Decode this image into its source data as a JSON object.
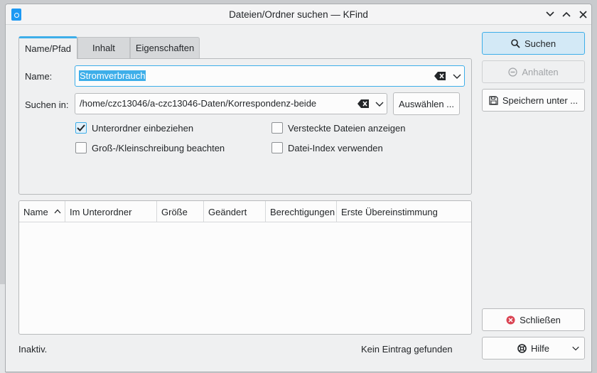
{
  "window": {
    "title": "Dateien/Ordner suchen — KFind"
  },
  "tabs": [
    {
      "label": "Name/Pfad",
      "active": true
    },
    {
      "label": "Inhalt",
      "active": false
    },
    {
      "label": "Eigenschaften",
      "active": false
    }
  ],
  "form": {
    "name_label": "Name:",
    "name_value": "Stromverbrauch",
    "lookin_label": "Suchen in:",
    "lookin_value": "/home/czc13046/a-czc13046-Daten/Korrespondenz-beide",
    "browse_label": "Auswählen ..."
  },
  "options": {
    "subfolders": {
      "label": "Unterordner einbeziehen",
      "checked": true
    },
    "case_sensitive": {
      "label": "Groß-/Kleinschreibung beachten",
      "checked": false
    },
    "hidden_files": {
      "label": "Versteckte Dateien anzeigen",
      "checked": false
    },
    "file_index": {
      "label": "Datei-Index verwenden",
      "checked": false
    }
  },
  "results": {
    "columns": [
      "Name",
      "Im Unterordner",
      "Größe",
      "Geändert",
      "Berechtigungen",
      "Erste Übereinstimmung"
    ],
    "sort_column": "Name",
    "sort_direction": "ascending",
    "rows": []
  },
  "buttons": {
    "search": "Suchen",
    "stop": "Anhalten",
    "save_as": "Speichern unter ...",
    "close": "Schließen",
    "help": "Hilfe"
  },
  "status": {
    "left": "Inaktiv.",
    "right": "Kein Eintrag gefunden"
  },
  "colors": {
    "accent": "#3daee9",
    "window_bg": "#eff0f1",
    "close_icon": "#da4453"
  }
}
